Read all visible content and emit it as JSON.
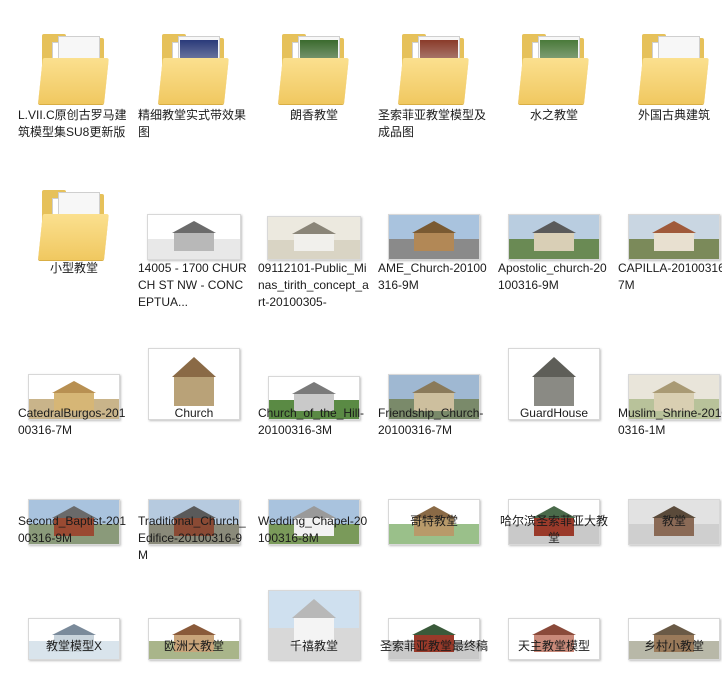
{
  "items": [
    {
      "name": "L.VII.C原创古罗马建筑模型集SU8更新版",
      "type": "folder",
      "preview": ""
    },
    {
      "name": "精细教堂实式带效果图",
      "type": "folder",
      "preview": "#2a3a7a"
    },
    {
      "name": "朗香教堂",
      "type": "folder",
      "preview": "#3b6b2e"
    },
    {
      "name": "圣索菲亚教堂模型及成品图",
      "type": "folder",
      "preview": "#8a3b2a"
    },
    {
      "name": "水之教堂",
      "type": "folder",
      "preview": "#4a7a3a"
    },
    {
      "name": "外国古典建筑",
      "type": "folder",
      "preview": ""
    },
    {
      "name": "小型教堂",
      "type": "folder",
      "preview": ""
    },
    {
      "name": "14005 - 1700 CHURCH ST NW - CONCEPTUA...",
      "type": "image",
      "sky": "#ffffff",
      "ground": "#e8e8e8",
      "bld": "#b8b8b8",
      "roof": "#6b6b6b"
    },
    {
      "name": "09112101-Public_Minas_tirith_concept_art-20100305-",
      "type": "image",
      "sky": "#ece9df",
      "ground": "#d9d4c4",
      "bld": "#f1f0ec",
      "roof": "#8a8578"
    },
    {
      "name": "AME_Church-20100316-9M",
      "type": "image",
      "sky": "#a9c3de",
      "ground": "#8a8a8a",
      "bld": "#b28856",
      "roof": "#7a5a32"
    },
    {
      "name": "Apostolic_church-20100316-9M",
      "type": "image",
      "sky": "#b9cde0",
      "ground": "#6a8a54",
      "bld": "#d9cfb6",
      "roof": "#5a5a5a"
    },
    {
      "name": "CAPILLA-20100316-7M",
      "type": "image",
      "sky": "#c9d6e2",
      "ground": "#7b8a5a",
      "bld": "#e8e0d0",
      "roof": "#a05a3a"
    },
    {
      "name": "CatedralBurgos-20100316-7M",
      "type": "image",
      "sky": "#ffffff",
      "ground": "#c9b48a",
      "bld": "#d6b676",
      "roof": "#b89052"
    },
    {
      "name": "Church",
      "type": "image",
      "sky": "#ffffff",
      "ground": "#ffffff",
      "bld": "#b9a278",
      "roof": "#8a6a46"
    },
    {
      "name": "Church_of_the_Hill-20100316-3M",
      "type": "image",
      "sky": "#ffffff",
      "ground": "#5a8a44",
      "bld": "#c9c9c9",
      "roof": "#7a7a7a"
    },
    {
      "name": "Friendship_Church-20100316-7M",
      "type": "image",
      "sky": "#9fb8d2",
      "ground": "#7a8a6a",
      "bld": "#cdbf9e",
      "roof": "#8a7a5a"
    },
    {
      "name": "GuardHouse",
      "type": "image",
      "sky": "#ffffff",
      "ground": "#ffffff",
      "bld": "#8a8a84",
      "roof": "#5e5e58"
    },
    {
      "name": "Muslim_Shrine-20100316-1M",
      "type": "image",
      "sky": "#e9e5da",
      "ground": "#b8c29a",
      "bld": "#d9cfb2",
      "roof": "#a99a74"
    },
    {
      "name": "Second_Baptist-20100316-9M",
      "type": "image",
      "sky": "#a9c3de",
      "ground": "#8a9a7a",
      "bld": "#9a4a32",
      "roof": "#6a6a6a"
    },
    {
      "name": "Traditional_Church_Edifice-20100316-9M",
      "type": "image",
      "sky": "#b6cadf",
      "ground": "#8a8a7a",
      "bld": "#8a4a34",
      "roof": "#5a5a5a"
    },
    {
      "name": "Wedding_Chapel-20100316-8M",
      "type": "image",
      "sky": "#a9c3de",
      "ground": "#7a9a5a",
      "bld": "#f2f2f2",
      "roof": "#9a9a9a"
    },
    {
      "name": "哥特教堂",
      "type": "image",
      "sky": "#ffffff",
      "ground": "#9ac08a",
      "bld": "#b89a6a",
      "roof": "#8a6a46"
    },
    {
      "name": "哈尔滨圣索菲亚大教堂",
      "type": "image",
      "sky": "#ffffff",
      "ground": "#c9c9c9",
      "bld": "#9a3a2a",
      "roof": "#4a6a4a"
    },
    {
      "name": "教堂",
      "type": "image",
      "sky": "#e2e2e2",
      "ground": "#cfcfcf",
      "bld": "#8a6a56",
      "roof": "#5a4a3a"
    },
    {
      "name": "教堂模型X",
      "type": "image",
      "sky": "#ffffff",
      "ground": "#d9e4ec",
      "bld": "#c9d4dc",
      "roof": "#7a8a9a"
    },
    {
      "name": "欧洲大教堂",
      "type": "image",
      "sky": "#ffffff",
      "ground": "#a9b58a",
      "bld": "#c9a47a",
      "roof": "#8a5a3a"
    },
    {
      "name": "千禧教堂",
      "type": "image",
      "sky": "#cfe0ef",
      "ground": "#d8d8d8",
      "bld": "#f4f4f4",
      "roof": "#b8b8b8"
    },
    {
      "name": "圣索菲亚教堂最终稿",
      "type": "image",
      "sky": "#ffffff",
      "ground": "#c9c9c9",
      "bld": "#9a3a2a",
      "roof": "#3a5a3a"
    },
    {
      "name": "天主教堂模型",
      "type": "image",
      "sky": "#ffffff",
      "ground": "#ffffff",
      "bld": "#c98a7a",
      "roof": "#8a4a3a"
    },
    {
      "name": "乡村小教堂",
      "type": "image",
      "sky": "#ffffff",
      "ground": "#b8b8a8",
      "bld": "#9a7a5a",
      "roof": "#6a5a46"
    }
  ]
}
